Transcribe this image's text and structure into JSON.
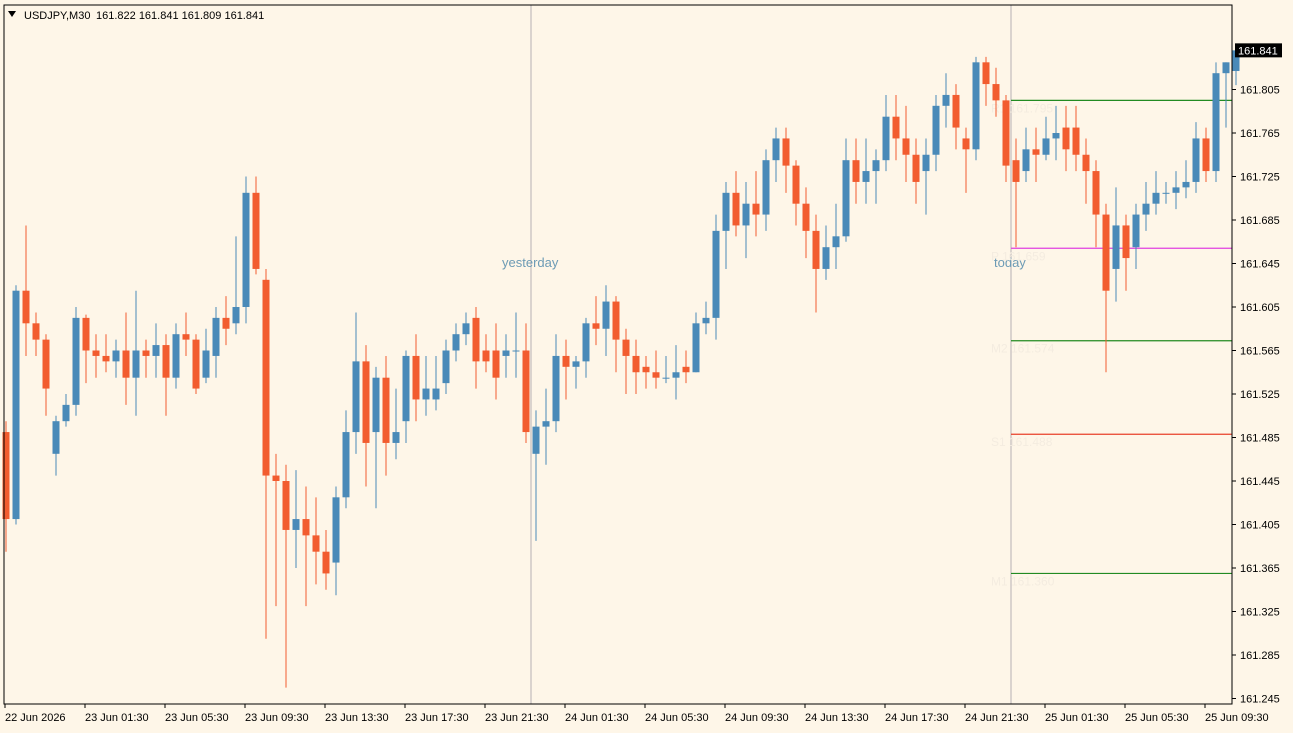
{
  "window": {
    "symbol": "USDJPY,M30",
    "ohlc": "161.822 161.841 161.809 161.841",
    "current_price": "161.841"
  },
  "colors": {
    "background": "#fef6e8",
    "bull": "#4a8ab8",
    "bear": "#f25c2f",
    "separator": "#b7b0b4",
    "badge": "#000000"
  },
  "icons": {
    "menu": "triangle-down-icon"
  },
  "chart_data": {
    "type": "candlestick",
    "symbol": "USDJPY",
    "timeframe": "M30",
    "ylim": [
      161.245,
      161.86
    ],
    "y_ticks": [
      "161.805",
      "161.765",
      "161.725",
      "161.685",
      "161.645",
      "161.605",
      "161.565",
      "161.525",
      "161.485",
      "161.445",
      "161.405",
      "161.365",
      "161.325",
      "161.285",
      "161.245"
    ],
    "x_ticks": [
      "22 Jun 2026",
      "23 Jun 01:30",
      "23 Jun 05:30",
      "23 Jun 09:30",
      "23 Jun 13:30",
      "23 Jun 17:30",
      "23 Jun 21:30",
      "24 Jun 01:30",
      "24 Jun 05:30",
      "24 Jun 09:30",
      "24 Jun 13:30",
      "24 Jun 17:30",
      "24 Jun 21:30",
      "25 Jun 01:30",
      "25 Jun 05:30",
      "25 Jun 09:30"
    ],
    "sessions": [
      {
        "label": "yesterday",
        "bar_index": 53
      },
      {
        "label": "today",
        "bar_index": 101
      }
    ],
    "levels": [
      {
        "label": "R1",
        "value": 161.795,
        "color": "#228b22"
      },
      {
        "label": "P",
        "value": 161.659,
        "color": "#e040e0"
      },
      {
        "label": "M2",
        "value": 161.574,
        "color": "#228b22"
      },
      {
        "label": "S1",
        "value": 161.488,
        "color": "#e8402a"
      },
      {
        "label": "M1",
        "value": 161.36,
        "color": "#228b22"
      }
    ],
    "candles": [
      [
        161.49,
        161.41,
        161.5,
        161.38
      ],
      [
        161.41,
        161.62,
        161.625,
        161.405
      ],
      [
        161.62,
        161.59,
        161.68,
        161.56
      ],
      [
        161.59,
        161.575,
        161.6,
        161.56
      ],
      [
        161.575,
        161.53,
        161.58,
        161.505
      ],
      [
        161.47,
        161.5,
        161.505,
        161.45
      ],
      [
        161.5,
        161.515,
        161.525,
        161.495
      ],
      [
        161.515,
        161.595,
        161.605,
        161.505
      ],
      [
        161.595,
        161.565,
        161.598,
        161.535
      ],
      [
        161.565,
        161.56,
        161.58,
        161.54
      ],
      [
        161.56,
        161.555,
        161.58,
        161.545
      ],
      [
        161.555,
        161.565,
        161.575,
        161.54
      ],
      [
        161.565,
        161.54,
        161.6,
        161.515
      ],
      [
        161.54,
        161.565,
        161.62,
        161.505
      ],
      [
        161.565,
        161.56,
        161.575,
        161.54
      ],
      [
        161.56,
        161.57,
        161.59,
        161.54
      ],
      [
        161.57,
        161.54,
        161.58,
        161.505
      ],
      [
        161.54,
        161.58,
        161.59,
        161.53
      ],
      [
        161.58,
        161.575,
        161.6,
        161.56
      ],
      [
        161.575,
        161.53,
        161.58,
        161.525
      ],
      [
        161.54,
        161.565,
        161.585,
        161.535
      ],
      [
        161.56,
        161.595,
        161.605,
        161.54
      ],
      [
        161.595,
        161.585,
        161.615,
        161.57
      ],
      [
        161.59,
        161.605,
        161.67,
        161.58
      ],
      [
        161.605,
        161.71,
        161.725,
        161.59
      ],
      [
        161.71,
        161.64,
        161.725,
        161.635
      ],
      [
        161.63,
        161.45,
        161.64,
        161.3
      ],
      [
        161.45,
        161.445,
        161.47,
        161.33
      ],
      [
        161.445,
        161.4,
        161.46,
        161.255
      ],
      [
        161.4,
        161.41,
        161.455,
        161.365
      ],
      [
        161.41,
        161.395,
        161.44,
        161.33
      ],
      [
        161.395,
        161.38,
        161.43,
        161.35
      ],
      [
        161.38,
        161.36,
        161.4,
        161.345
      ],
      [
        161.37,
        161.43,
        161.44,
        161.34
      ],
      [
        161.43,
        161.49,
        161.51,
        161.42
      ],
      [
        161.49,
        161.555,
        161.6,
        161.47
      ],
      [
        161.555,
        161.48,
        161.57,
        161.44
      ],
      [
        161.49,
        161.54,
        161.55,
        161.42
      ],
      [
        161.54,
        161.48,
        161.56,
        161.45
      ],
      [
        161.48,
        161.49,
        161.53,
        161.465
      ],
      [
        161.5,
        161.56,
        161.565,
        161.48
      ],
      [
        161.56,
        161.52,
        161.58,
        161.5
      ],
      [
        161.52,
        161.53,
        161.56,
        161.505
      ],
      [
        161.52,
        161.53,
        161.56,
        161.51
      ],
      [
        161.535,
        161.565,
        161.575,
        161.525
      ],
      [
        161.565,
        161.58,
        161.59,
        161.555
      ],
      [
        161.58,
        161.59,
        161.6,
        161.57
      ],
      [
        161.595,
        161.555,
        161.605,
        161.53
      ],
      [
        161.565,
        161.555,
        161.58,
        161.545
      ],
      [
        161.565,
        161.54,
        161.59,
        161.52
      ],
      [
        161.56,
        161.565,
        161.58,
        161.54
      ],
      [
        161.565,
        161.565,
        161.6,
        161.54
      ],
      [
        161.565,
        161.49,
        161.59,
        161.48
      ],
      [
        161.47,
        161.495,
        161.51,
        161.39
      ],
      [
        161.495,
        161.5,
        161.53,
        161.46
      ],
      [
        161.5,
        161.56,
        161.58,
        161.49
      ],
      [
        161.56,
        161.55,
        161.575,
        161.52
      ],
      [
        161.55,
        161.555,
        161.56,
        161.53
      ],
      [
        161.555,
        161.59,
        161.595,
        161.54
      ],
      [
        161.59,
        161.585,
        161.615,
        161.57
      ],
      [
        161.585,
        161.61,
        161.625,
        161.56
      ],
      [
        161.61,
        161.575,
        161.615,
        161.545
      ],
      [
        161.575,
        161.56,
        161.585,
        161.525
      ],
      [
        161.56,
        161.545,
        161.575,
        161.525
      ],
      [
        161.55,
        161.545,
        161.56,
        161.53
      ],
      [
        161.545,
        161.54,
        161.565,
        161.53
      ],
      [
        161.54,
        161.54,
        161.56,
        161.535
      ],
      [
        161.54,
        161.545,
        161.57,
        161.52
      ],
      [
        161.55,
        161.545,
        161.565,
        161.535
      ],
      [
        161.545,
        161.59,
        161.6,
        161.545
      ],
      [
        161.59,
        161.595,
        161.61,
        161.58
      ],
      [
        161.595,
        161.675,
        161.69,
        161.575
      ],
      [
        161.675,
        161.71,
        161.72,
        161.64
      ],
      [
        161.71,
        161.68,
        161.73,
        161.67
      ],
      [
        161.68,
        161.7,
        161.72,
        161.65
      ],
      [
        161.7,
        161.69,
        161.73,
        161.67
      ],
      [
        161.69,
        161.74,
        161.75,
        161.675
      ],
      [
        161.74,
        161.76,
        161.77,
        161.72
      ],
      [
        161.76,
        161.735,
        161.77,
        161.71
      ],
      [
        161.735,
        161.7,
        161.74,
        161.68
      ],
      [
        161.7,
        161.675,
        161.715,
        161.65
      ],
      [
        161.675,
        161.64,
        161.69,
        161.6
      ],
      [
        161.64,
        161.66,
        161.68,
        161.63
      ],
      [
        161.66,
        161.67,
        161.7,
        161.64
      ],
      [
        161.67,
        161.74,
        161.76,
        161.665
      ],
      [
        161.74,
        161.72,
        161.76,
        161.7
      ],
      [
        161.72,
        161.73,
        161.76,
        161.7
      ],
      [
        161.73,
        161.74,
        161.75,
        161.7
      ],
      [
        161.74,
        161.78,
        161.8,
        161.73
      ],
      [
        161.78,
        161.76,
        161.8,
        161.74
      ],
      [
        161.76,
        161.745,
        161.79,
        161.72
      ],
      [
        161.745,
        161.72,
        161.76,
        161.7
      ],
      [
        161.73,
        161.745,
        161.76,
        161.69
      ],
      [
        161.745,
        161.79,
        161.8,
        161.73
      ],
      [
        161.79,
        161.8,
        161.82,
        161.77
      ],
      [
        161.8,
        161.77,
        161.81,
        161.75
      ],
      [
        161.76,
        161.75,
        161.77,
        161.71
      ],
      [
        161.75,
        161.83,
        161.835,
        161.74
      ],
      [
        161.83,
        161.81,
        161.835,
        161.79
      ],
      [
        161.81,
        161.795,
        161.825,
        161.78
      ],
      [
        161.795,
        161.735,
        161.8,
        161.72
      ],
      [
        161.74,
        161.72,
        161.76,
        161.66
      ],
      [
        161.73,
        161.75,
        161.77,
        161.72
      ],
      [
        161.75,
        161.745,
        161.77,
        161.72
      ],
      [
        161.745,
        161.76,
        161.78,
        161.74
      ],
      [
        161.76,
        161.765,
        161.79,
        161.74
      ],
      [
        161.77,
        161.75,
        161.79,
        161.73
      ],
      [
        161.77,
        161.745,
        161.79,
        161.73
      ],
      [
        161.745,
        161.73,
        161.76,
        161.7
      ],
      [
        161.73,
        161.69,
        161.74,
        161.66
      ],
      [
        161.69,
        161.62,
        161.7,
        161.545
      ],
      [
        161.64,
        161.68,
        161.715,
        161.61
      ],
      [
        161.68,
        161.65,
        161.69,
        161.62
      ],
      [
        161.66,
        161.69,
        161.7,
        161.64
      ],
      [
        161.69,
        161.7,
        161.72,
        161.675
      ],
      [
        161.7,
        161.71,
        161.73,
        161.69
      ],
      [
        161.71,
        161.71,
        161.72,
        161.7
      ],
      [
        161.71,
        161.715,
        161.73,
        161.695
      ],
      [
        161.715,
        161.72,
        161.74,
        161.705
      ],
      [
        161.72,
        161.76,
        161.775,
        161.71
      ],
      [
        161.76,
        161.73,
        161.77,
        161.72
      ],
      [
        161.73,
        161.82,
        161.83,
        161.72
      ],
      [
        161.82,
        161.83,
        161.83,
        161.77
      ],
      [
        161.822,
        161.841,
        161.845,
        161.809
      ]
    ]
  }
}
